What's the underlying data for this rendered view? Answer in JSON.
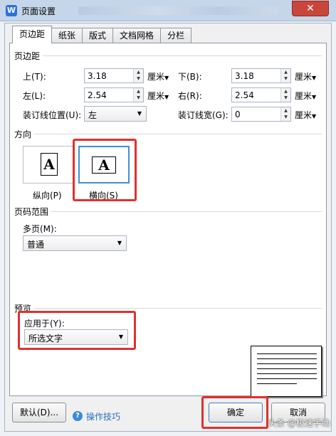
{
  "window": {
    "title": "页面设置",
    "app_icon_glyph": "W",
    "close_glyph": "✕"
  },
  "tabs": [
    "页边距",
    "纸张",
    "版式",
    "文档网格",
    "分栏"
  ],
  "margins": {
    "group_label": "页边距",
    "top": {
      "label": "上(T):",
      "value": "3.18",
      "unit": "厘米"
    },
    "bottom": {
      "label": "下(B):",
      "value": "3.18",
      "unit": "厘米"
    },
    "left": {
      "label": "左(L):",
      "value": "2.54",
      "unit": "厘米"
    },
    "right": {
      "label": "右(R):",
      "value": "2.54",
      "unit": "厘米"
    },
    "gutter_position": {
      "label": "装订线位置(U):",
      "value": "左"
    },
    "gutter_width": {
      "label": "装订线宽(G):",
      "value": "0",
      "unit": "厘米"
    }
  },
  "orientation": {
    "group_label": "方向",
    "portrait": {
      "label": "纵向(P)",
      "icon_glyph": "A"
    },
    "landscape": {
      "label": "横向(S)",
      "icon_glyph": "A"
    },
    "selected": "landscape"
  },
  "page_range": {
    "group_label": "页码范围",
    "multiple_pages_label": "多页(M):",
    "multiple_pages_value": "普通"
  },
  "preview": {
    "group_label": "预览",
    "apply_to_label": "应用于(Y):",
    "apply_to_value": "所选文字"
  },
  "footer": {
    "default_button": "默认(D)...",
    "tips_link": "操作技巧",
    "ok_button": "确定",
    "cancel_button": "取消"
  },
  "watermark": "头条 @极速手助",
  "colors": {
    "highlight": "#e0312e",
    "selection": "#3f8fd6",
    "link": "#2b6ec2"
  }
}
